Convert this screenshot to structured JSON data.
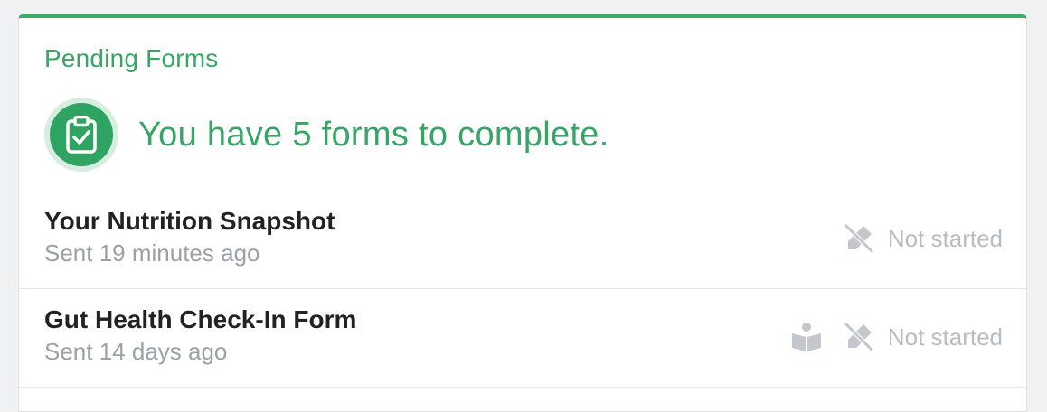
{
  "card": {
    "title": "Pending Forms",
    "summary_text": "You have 5 forms to complete.",
    "summary_icon": "clipboard-check-icon",
    "accent_color": "#36a565"
  },
  "forms": [
    {
      "name": "Your Nutrition Snapshot",
      "sent": "Sent 19 minutes ago",
      "status": "Not started",
      "status_icon": "pencil-slash-icon"
    },
    {
      "name": "Gut Health Check-In Form",
      "sent": "Sent 14 days ago",
      "extra_icon": "person-reading-icon",
      "status": "Not started",
      "status_icon": "pencil-slash-icon"
    }
  ]
}
